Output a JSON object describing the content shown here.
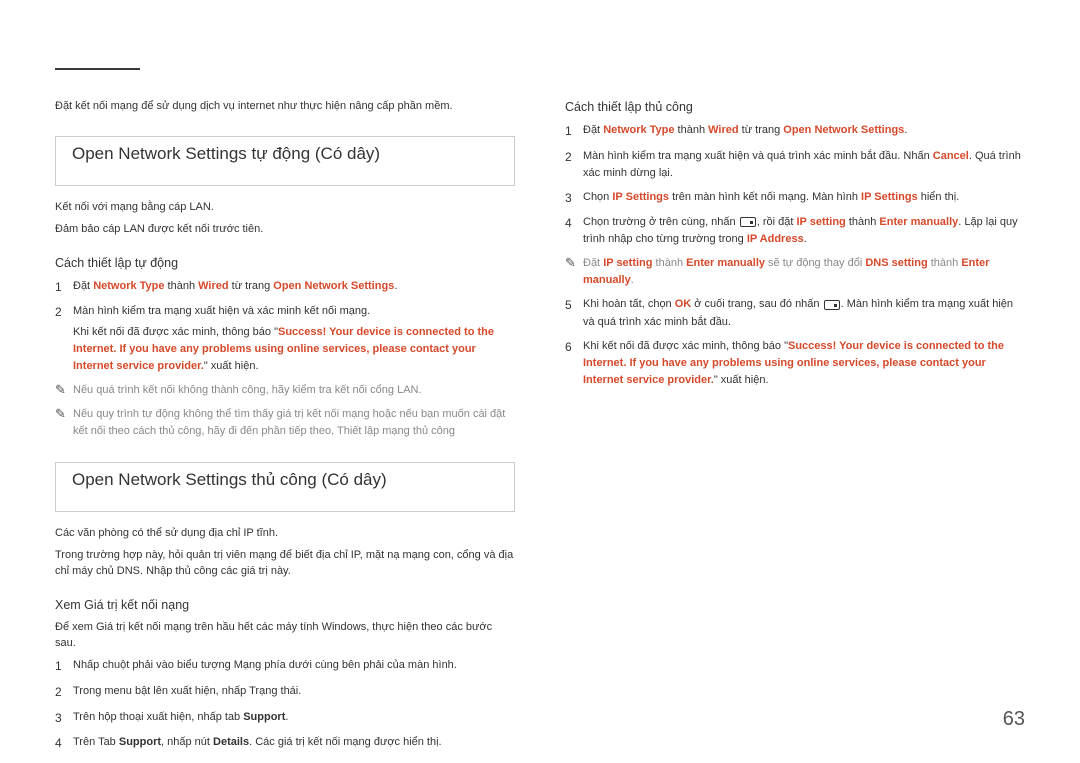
{
  "intro": "Đặt kết nối mạng để sử dụng dịch vụ internet như thực hiện nâng cấp phần mềm.",
  "left": {
    "h2a": "Open Network Settings tự động (Có dây)",
    "p1": "Kết nối với mạng bằng cáp LAN.",
    "p2": "Đảm bảo cáp LAN được kết nối trước tiên.",
    "h3a": "Cách thiết lập tự động",
    "steps_a": [
      {
        "n": "1",
        "t": "Đặt <span class='red'><b>Network Type</b></span> thành <span class='red'><b>Wired</b></span> từ trang <span class='red'><b>Open Network Settings</b></span>."
      },
      {
        "n": "2",
        "t": "Màn hình kiểm tra mạng xuất hiện và xác minh kết nối mạng.<br><span class='sub'>Khi kết nối đã được xác minh, thông báo \"<span class='red'><b>Success! Your device is connected to the Internet. If you have any problems using online services, please contact your Internet service provider.</b></span>\" xuất hiện.</span>"
      }
    ],
    "notes_a": [
      "Nếu quá trình kết nối không thành công, hãy kiểm tra kết nối cổng LAN.",
      "Nếu quy trình tự động không thể tìm thấy giá trị kết nối mạng hoặc nếu bạn muốn cài đặt kết nối theo cách thủ công, hãy đi đến phần tiếp theo, Thiết lập mạng thủ công"
    ],
    "h2b": "Open Network Settings thủ công (Có dây)",
    "p3": "Các văn phòng có thể sử dụng địa chỉ IP tĩnh.",
    "p4": "Trong trường hợp này, hỏi quản trị viên mạng để biết địa chỉ IP, mặt nạ mạng con, cổng và địa chỉ máy chủ DNS. Nhập thủ công các giá trị này.",
    "h3b": "Xem Giá trị kết nối nạng",
    "p5": "Để xem Giá trị kết nối mạng trên hầu hết các máy tính Windows, thực hiện theo các bước sau.",
    "steps_b": [
      {
        "n": "1",
        "t": "Nhấp chuột phải vào biểu tượng Mạng phía dưới cùng bên phải của màn hình."
      },
      {
        "n": "2",
        "t": "Trong menu bật lên xuất hiện, nhấp Trạng thái."
      },
      {
        "n": "3",
        "t": "Trên hộp thoại xuất hiện, nhấp tab <b>Support</b>."
      },
      {
        "n": "4",
        "t": "Trên Tab <b>Support</b>, nhấp nút <b>Details</b>. Các giá trị kết nối mạng được hiển thị."
      }
    ]
  },
  "right": {
    "h3": "Cách thiết lập thủ công",
    "steps": [
      {
        "n": "1",
        "t": "Đặt <span class='red'><b>Network Type</b></span> thành <span class='red'><b>Wired</b></span> từ trang <span class='red'><b>Open Network Settings</b></span>."
      },
      {
        "n": "2",
        "t": "Màn hình kiểm tra mạng xuất hiện và quá trình xác minh bắt đầu. Nhấn <span class='red'><b>Cancel</b></span>. Quá trình xác minh dừng lại."
      },
      {
        "n": "3",
        "t": "Chọn <span class='red'><b>IP Settings</b></span> trên màn hình kết nối mạng. Màn hình <span class='red'><b>IP Settings</b></span> hiển thị."
      },
      {
        "n": "4",
        "t": "Chọn trường ở trên cùng, nhấn <span class='enter-icon' data-name='enter-key-icon'></span>, rồi đặt <span class='red'><b>IP setting</b></span> thành <span class='red'><b>Enter manually</b></span>. Lặp lại quy trình nhập cho từng trường trong <span class='red'><b>IP Address</b></span>."
      },
      {
        "note": true,
        "t": "<span class='gray'>Đặt </span><span class='red'><b>IP setting</b></span><span class='gray'> thành </span><span class='red'><b>Enter manually</b></span><span class='gray'> sẽ tự động thay đổi </span><span class='red'><b>DNS setting</b></span><span class='gray'> thành </span><span class='red'><b>Enter manually</b></span><span class='gray'>.</span>"
      },
      {
        "n": "5",
        "t": "Khi hoàn tất, chọn <span class='red'><b>OK</b></span> ở cuối trang, sau đó nhấn <span class='enter-icon' data-name='enter-key-icon'></span>. Màn hình kiểm tra mạng xuất hiện và quá trình xác minh bắt đầu."
      },
      {
        "n": "6",
        "t": "Khi kết nối đã được xác minh, thông báo \"<span class='red'><b>Success! Your device is connected to the Internet. If you have any problems using online services, please contact your Internet service provider.</b></span>\" xuất hiện."
      }
    ]
  },
  "page": "63"
}
